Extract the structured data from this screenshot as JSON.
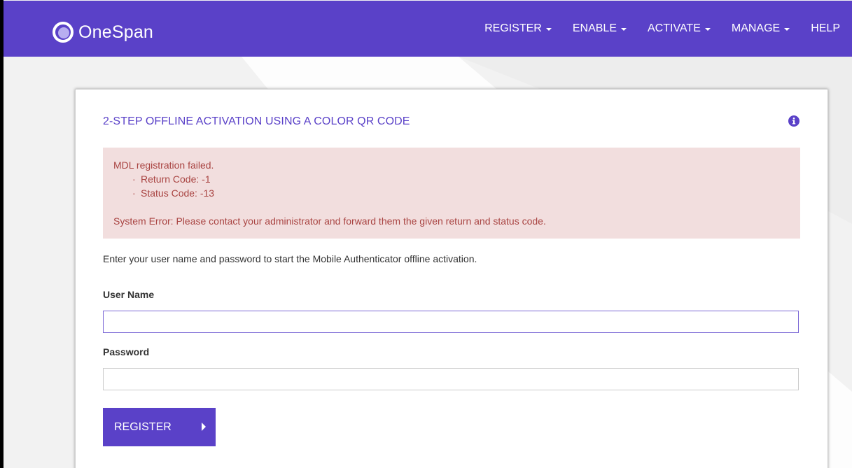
{
  "brand": {
    "name": "OneSpan"
  },
  "nav": [
    {
      "label": "REGISTER",
      "has_dropdown": true
    },
    {
      "label": "ENABLE",
      "has_dropdown": true
    },
    {
      "label": "ACTIVATE",
      "has_dropdown": true
    },
    {
      "label": "MANAGE",
      "has_dropdown": true
    },
    {
      "label": "HELP",
      "has_dropdown": false
    }
  ],
  "card": {
    "title": "2-STEP OFFLINE ACTIVATION USING A COLOR QR CODE",
    "info_icon": "info-circle-icon"
  },
  "alert": {
    "heading": "MDL registration failed.",
    "items": [
      "Return Code: -1",
      "Status Code: -13"
    ],
    "message": "System Error: Please contact your administrator and forward them the given return and status code."
  },
  "intro": "Enter your user name and password to start the Mobile Authenticator offline activation.",
  "form": {
    "username_label": "User Name",
    "username_value": "",
    "password_label": "Password",
    "password_value": "",
    "submit_label": "REGISTER"
  },
  "colors": {
    "brand": "#5a41c8",
    "alert_bg": "#f2dede",
    "alert_text": "#a94442"
  }
}
